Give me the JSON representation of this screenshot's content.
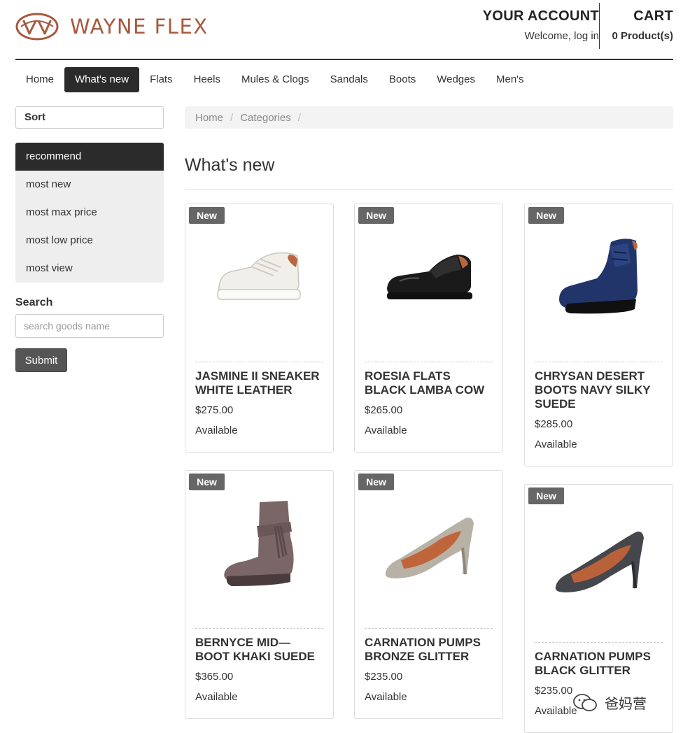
{
  "brand": {
    "name": "WAYNE FLEX",
    "color": "#a8593e"
  },
  "account": {
    "title": "YOUR ACCOUNT",
    "subtitle": "Welcome, log in"
  },
  "cart": {
    "title": "CART",
    "count_label": "0 Product(s)"
  },
  "nav": {
    "items": [
      {
        "label": "Home"
      },
      {
        "label": "What's new",
        "active": true
      },
      {
        "label": "Flats"
      },
      {
        "label": "Heels"
      },
      {
        "label": "Mules & Clogs"
      },
      {
        "label": "Sandals"
      },
      {
        "label": "Boots"
      },
      {
        "label": "Wedges"
      },
      {
        "label": "Men's"
      }
    ]
  },
  "sidebar": {
    "sort_label": "Sort",
    "sort_options": [
      {
        "label": "recommend",
        "active": true
      },
      {
        "label": "most new"
      },
      {
        "label": "most max price"
      },
      {
        "label": "most low price"
      },
      {
        "label": "most view"
      }
    ],
    "search_label": "Search",
    "search_placeholder": "search goods name",
    "submit_label": "Submit"
  },
  "breadcrumb": {
    "items": [
      "Home",
      "Categories"
    ],
    "sep": "/"
  },
  "page_title": "What's new",
  "products": [
    {
      "badge": "New",
      "name": "JASMINE II SNEAKER WHITE LEATHER",
      "price": "$275.00",
      "status": "Available",
      "icon": "sneaker-image"
    },
    {
      "badge": "New",
      "name": "ROESIA FLATS BLACK LAMBA COW",
      "price": "$265.00",
      "status": "Available",
      "icon": "flat-shoe-image"
    },
    {
      "badge": "New",
      "name": "CHRYSAN DESERT BOOTS NAVY SILKY SUEDE",
      "price": "$285.00",
      "status": "Available",
      "icon": "desert-boot-image"
    },
    {
      "badge": "New",
      "name": "BERNYCE MID—BOOT KHAKI SUEDE",
      "price": "$365.00",
      "status": "Available",
      "icon": "mid-boot-image"
    },
    {
      "badge": "New",
      "name": "CARNATION PUMPS BRONZE GLITTER",
      "price": "$235.00",
      "status": "Available",
      "icon": "pump-image"
    },
    {
      "badge": "New",
      "name": "CARNATION PUMPS BLACK GLITTER",
      "price": "$235.00",
      "status": "Available",
      "icon": "pump-image"
    }
  ],
  "watermark": {
    "text": "爸妈营"
  }
}
